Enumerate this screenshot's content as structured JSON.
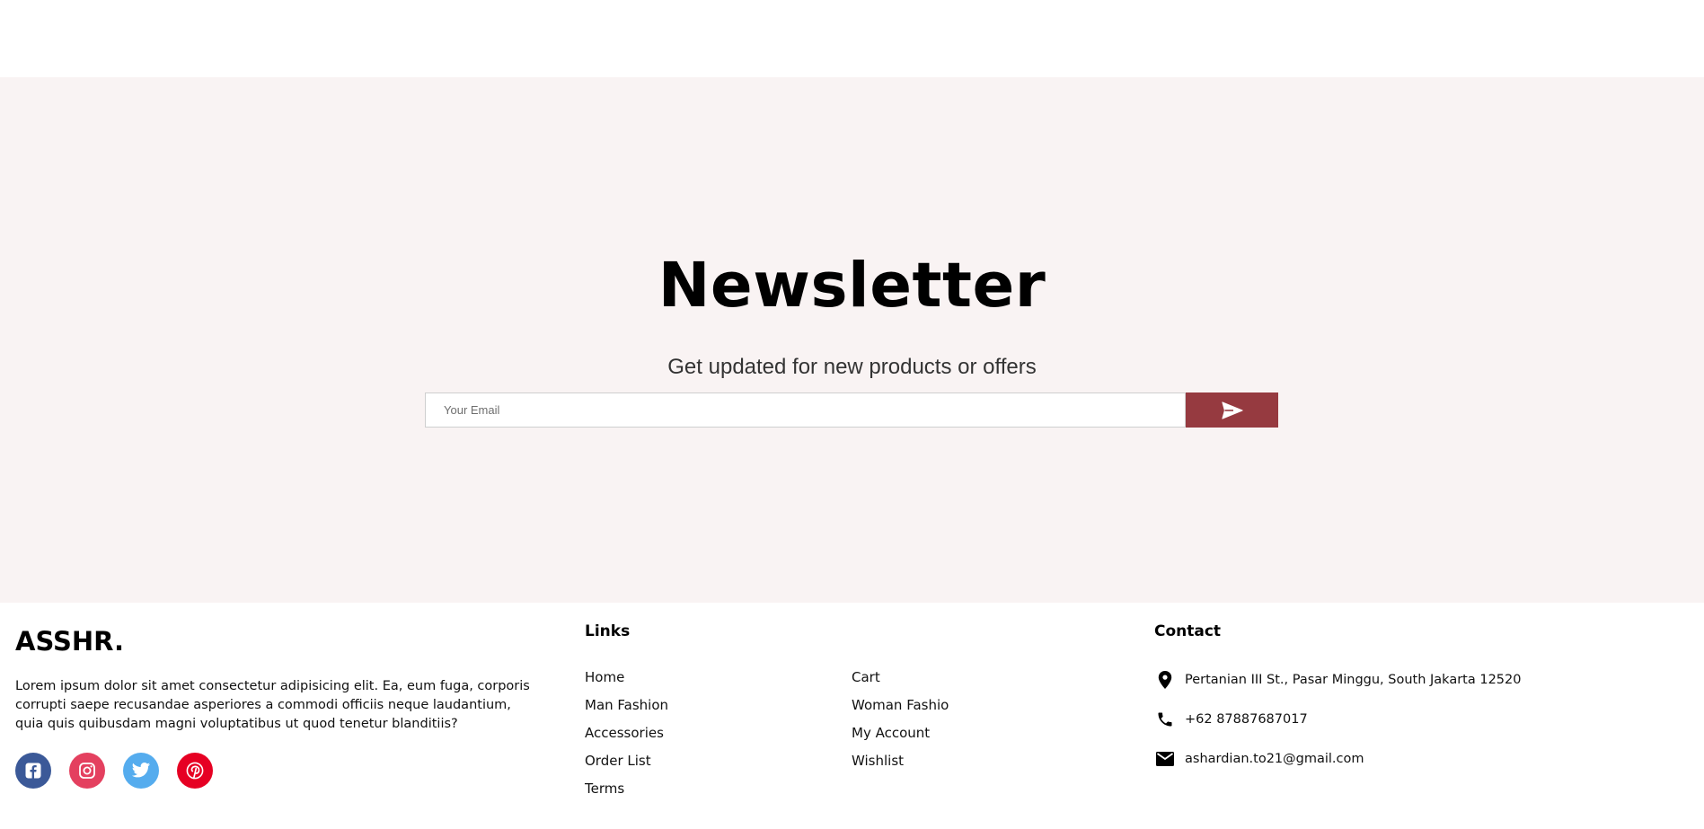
{
  "newsletter": {
    "title": "Newsletter",
    "subtitle": "Get updated for new products or offers",
    "email_placeholder": "Your Email",
    "submit_icon": "send-icon",
    "background": "#f9f3f3",
    "button_color": "#963a40"
  },
  "footer": {
    "brand": "ASSHR.",
    "description": "Lorem ipsum dolor sit amet consectetur adipisicing elit. Ea, eum fuga, corporis corrupti saepe recusandae asperiores a commodi officiis neque laudantium, quia quis quibusdam magni voluptatibus ut quod tenetur blanditiis?",
    "socials": [
      {
        "name": "facebook-icon",
        "color": "#3b5998"
      },
      {
        "name": "instagram-icon",
        "color": "#e4405f"
      },
      {
        "name": "twitter-icon",
        "color": "#55acee"
      },
      {
        "name": "pinterest-icon",
        "color": "#e60023"
      }
    ],
    "links": {
      "title": "Links",
      "col1": [
        "Home",
        "Man Fashion",
        "Accessories",
        "Order List",
        "Terms"
      ],
      "col2": [
        "Cart",
        "Woman Fashio",
        "My Account",
        "Wishlist"
      ]
    },
    "contact": {
      "title": "Contact",
      "address": "Pertanian III St., Pasar Minggu, South Jakarta 12520",
      "phone": "+62 87887687017",
      "email": "ashardian.to21@gmail.com"
    }
  }
}
